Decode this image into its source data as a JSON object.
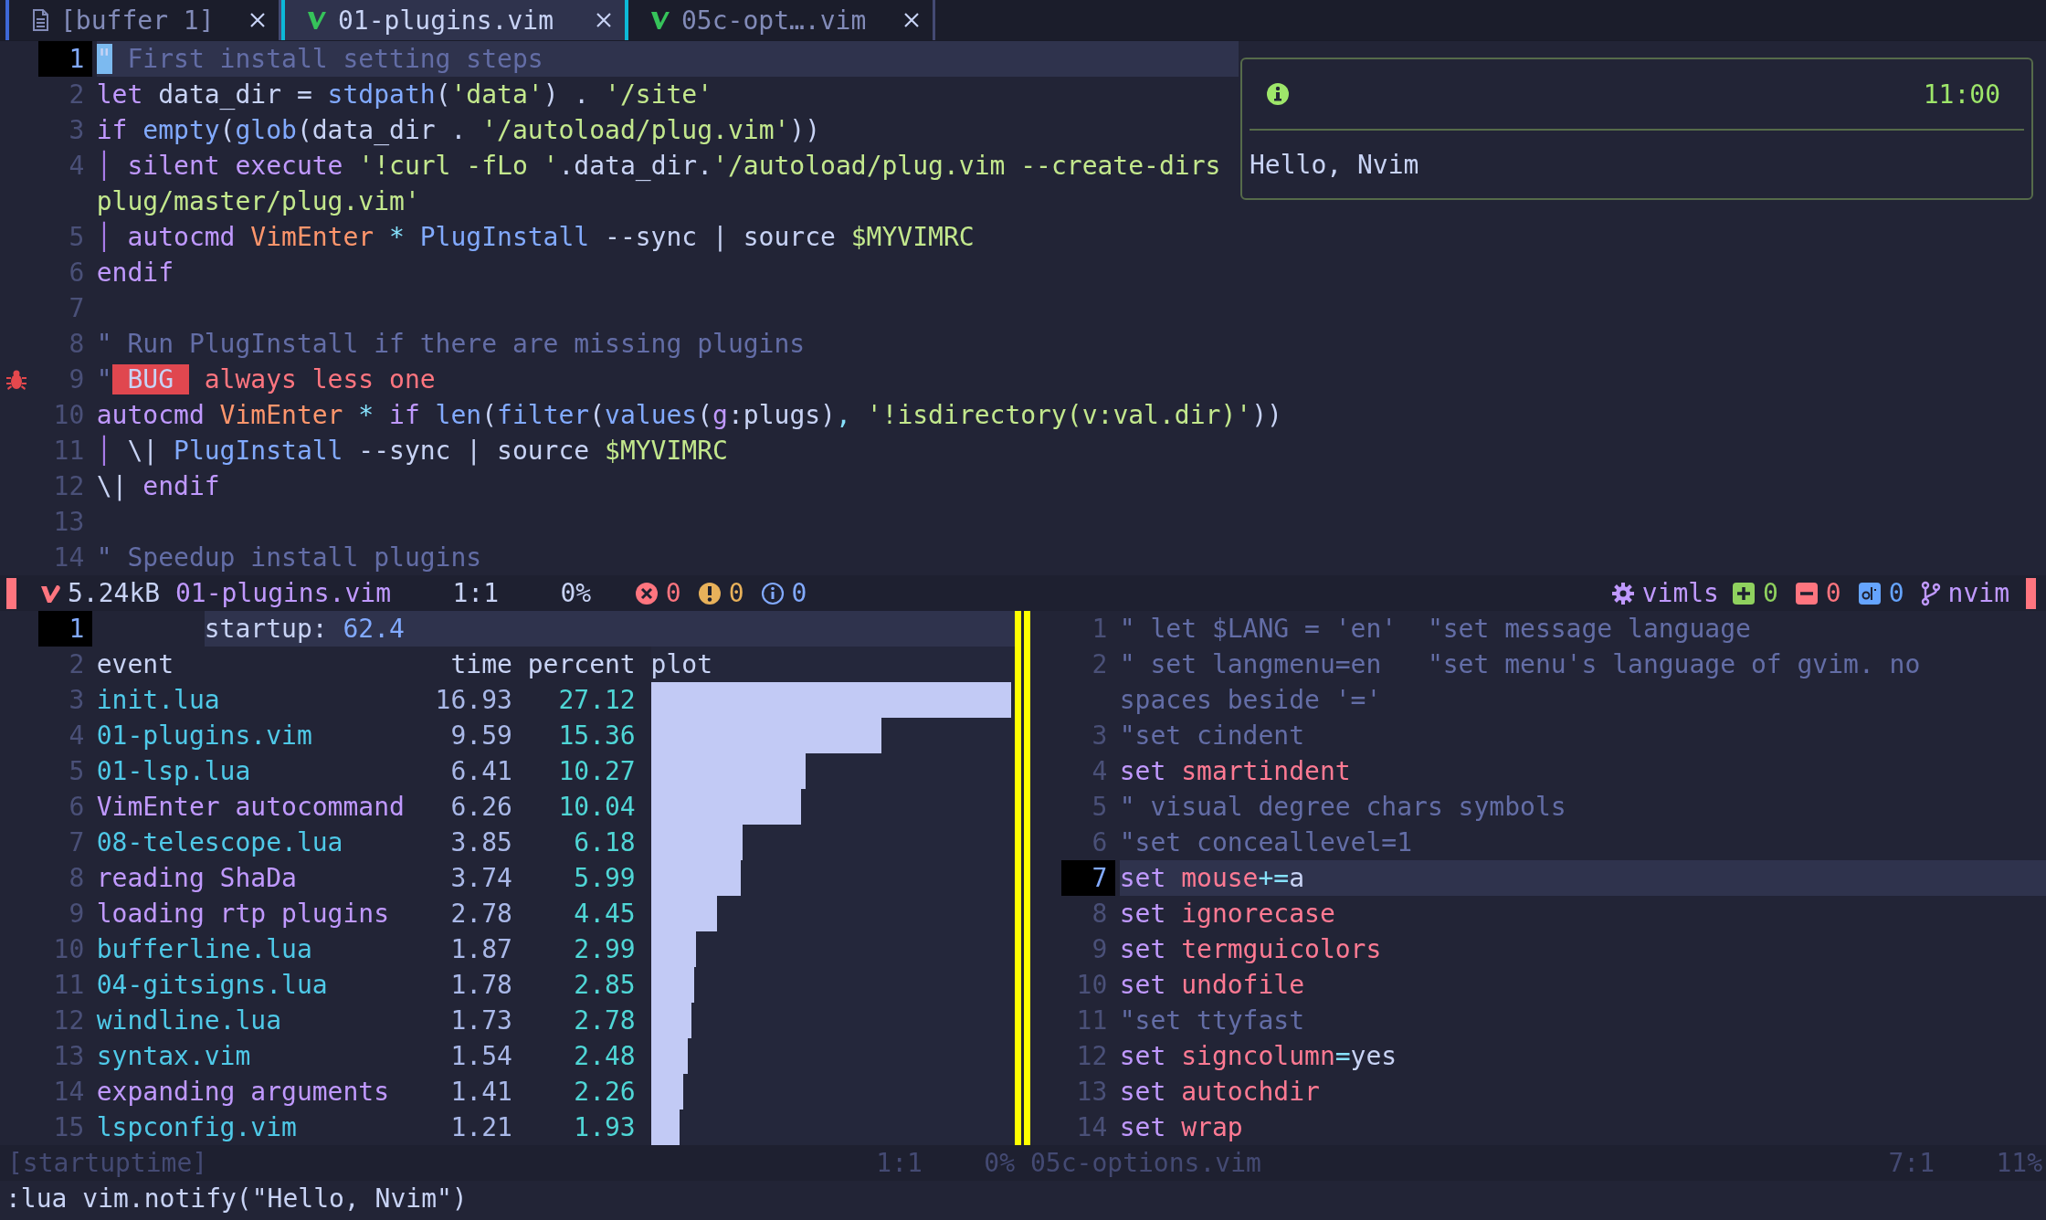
{
  "tabline": {
    "tabs": [
      {
        "label": "[buffer 1]",
        "kind": "scratch",
        "selected": false
      },
      {
        "label": "01-plugins.vim",
        "kind": "vim",
        "selected": true
      },
      {
        "label": "05c-opt….vim",
        "kind": "vim",
        "selected": false
      }
    ]
  },
  "top_editor": {
    "lines": [
      {
        "number": "1",
        "current": true,
        "tokens": [
          {
            "kind": "cursor",
            "text": "\""
          },
          {
            "kind": "comment",
            "text": " First install setting steps"
          }
        ]
      },
      {
        "number": "2",
        "current": false,
        "tokens": [
          {
            "kind": "keyword",
            "text": "let"
          },
          {
            "kind": "text",
            "text": " data_dir = "
          },
          {
            "kind": "function",
            "text": "stdpath"
          },
          {
            "kind": "text",
            "text": "("
          },
          {
            "kind": "string",
            "text": "'data'"
          },
          {
            "kind": "text",
            "text": ") . "
          },
          {
            "kind": "string",
            "text": "'/site'"
          }
        ]
      },
      {
        "number": "3",
        "current": false,
        "tokens": [
          {
            "kind": "keyword",
            "text": "if"
          },
          {
            "kind": "function",
            "text": " empty"
          },
          {
            "kind": "text",
            "text": "("
          },
          {
            "kind": "function",
            "text": "glob"
          },
          {
            "kind": "text",
            "text": "(data_dir . "
          },
          {
            "kind": "string",
            "text": "'/autoload/plug.vim'"
          },
          {
            "kind": "text",
            "text": "))"
          }
        ]
      },
      {
        "number": "4",
        "current": false,
        "tokens": [
          {
            "kind": "guide",
            "text": "│"
          },
          {
            "kind": "keyword",
            "text": " silent execute"
          },
          {
            "kind": "string",
            "text": " '!curl -fLo '"
          },
          {
            "kind": "text",
            "text": ".data_dir."
          },
          {
            "kind": "string",
            "text": "'/autoload/plug.vim --create-dirs"
          }
        ],
        "wrap": [
          {
            "kind": "string",
            "text": "plug/master/plug.vim'"
          }
        ]
      },
      {
        "number": "5",
        "current": false,
        "tokens": [
          {
            "kind": "guide",
            "text": "│"
          },
          {
            "kind": "keyword",
            "text": " autocmd"
          },
          {
            "kind": "type",
            "text": " VimEnter"
          },
          {
            "kind": "operator",
            "text": " *"
          },
          {
            "kind": "function",
            "text": " PlugInstall"
          },
          {
            "kind": "text",
            "text": " --sync | source "
          },
          {
            "kind": "string",
            "text": "$MYVIMRC"
          }
        ]
      },
      {
        "number": "6",
        "current": false,
        "tokens": [
          {
            "kind": "keyword",
            "text": "endif"
          }
        ]
      },
      {
        "number": "7",
        "current": false
      },
      {
        "number": "8",
        "current": false,
        "tokens": [
          {
            "kind": "comment",
            "text": "\" Run PlugInstall if there are missing plugins"
          }
        ]
      },
      {
        "number": "9",
        "current": false,
        "flagged": true,
        "tokens": [
          {
            "kind": "comment",
            "text": "\""
          },
          {
            "kind": "tag",
            "text": " BUG "
          },
          {
            "kind": "error",
            "text": " always less one"
          }
        ]
      },
      {
        "number": "10",
        "current": false,
        "tokens": [
          {
            "kind": "keyword",
            "text": "autocmd"
          },
          {
            "kind": "type",
            "text": " VimEnter"
          },
          {
            "kind": "operator",
            "text": " *"
          },
          {
            "kind": "keyword",
            "text": " if"
          },
          {
            "kind": "function",
            "text": " len"
          },
          {
            "kind": "text",
            "text": "("
          },
          {
            "kind": "function",
            "text": "filter"
          },
          {
            "kind": "text",
            "text": "("
          },
          {
            "kind": "function",
            "text": "values"
          },
          {
            "kind": "text",
            "text": "("
          },
          {
            "kind": "keyword",
            "text": "g"
          },
          {
            "kind": "text",
            "text": ":plugs)"
          },
          {
            "kind": "operator",
            "text": ","
          },
          {
            "kind": "string",
            "text": " '!isdirectory(v:val.dir)'"
          },
          {
            "kind": "text",
            "text": "))"
          }
        ]
      },
      {
        "number": "11",
        "current": false,
        "tokens": [
          {
            "kind": "guide",
            "text": "│"
          },
          {
            "kind": "text",
            "text": " \\| "
          },
          {
            "kind": "function",
            "text": "PlugInstall"
          },
          {
            "kind": "text",
            "text": " --sync | source "
          },
          {
            "kind": "string",
            "text": "$MYVIMRC"
          }
        ]
      },
      {
        "number": "12",
        "current": false,
        "tokens": [
          {
            "kind": "text",
            "text": "\\| "
          },
          {
            "kind": "keyword",
            "text": "endif"
          }
        ]
      },
      {
        "number": "13",
        "current": false
      },
      {
        "number": "14",
        "current": false,
        "tokens": [
          {
            "kind": "comment",
            "text": "\" Speedup install plugins"
          }
        ]
      }
    ]
  },
  "notification": {
    "time": "11:00",
    "message": "Hello, Nvim"
  },
  "statusline": {
    "size": "5.24kB",
    "file": "01-plugins.vim",
    "position": "1:1",
    "percent": "0%",
    "diagnostics": [
      {
        "kind": "error",
        "count": "0"
      },
      {
        "kind": "warning",
        "count": "0"
      },
      {
        "kind": "info",
        "count": "0"
      }
    ],
    "lsp": "vimls",
    "git": [
      {
        "kind": "added",
        "count": "0"
      },
      {
        "kind": "removed",
        "count": "0"
      },
      {
        "kind": "changed",
        "count": "0"
      }
    ],
    "branch": "nvim"
  },
  "startuptime": {
    "summary": {
      "number": "1",
      "current": true,
      "label": "startup:",
      "value": "62.4"
    },
    "header": {
      "number": "2",
      "columns": [
        "event",
        "time",
        "percent",
        "plot"
      ]
    },
    "rows": [
      {
        "number": "3",
        "kind": "file",
        "event": "init.lua",
        "time": "16.93",
        "percent": "27.12",
        "level": 1.0
      },
      {
        "number": "4",
        "kind": "file",
        "event": "01-plugins.vim",
        "time": "9.59",
        "percent": "15.36",
        "level": 0.641
      },
      {
        "number": "5",
        "kind": "file",
        "event": "01-lsp.lua",
        "time": "6.41",
        "percent": "10.27",
        "level": 0.429
      },
      {
        "number": "6",
        "kind": "event",
        "event": "VimEnter autocommand",
        "time": "6.26",
        "percent": "10.04",
        "level": 0.418
      },
      {
        "number": "7",
        "kind": "file",
        "event": "08-telescope.lua",
        "time": "3.85",
        "percent": "6.18",
        "level": 0.255
      },
      {
        "number": "8",
        "kind": "event",
        "event": "reading ShaDa",
        "time": "3.74",
        "percent": "5.99",
        "level": 0.249
      },
      {
        "number": "9",
        "kind": "event",
        "event": "loading rtp plugins",
        "time": "2.78",
        "percent": "4.45",
        "level": 0.184
      },
      {
        "number": "10",
        "kind": "file",
        "event": "bufferline.lua",
        "time": "1.87",
        "percent": "2.99",
        "level": 0.125
      },
      {
        "number": "11",
        "kind": "file",
        "event": "04-gitsigns.lua",
        "time": "1.78",
        "percent": "2.85",
        "level": 0.119
      },
      {
        "number": "12",
        "kind": "file",
        "event": "windline.lua",
        "time": "1.73",
        "percent": "2.78",
        "level": 0.113
      },
      {
        "number": "13",
        "kind": "file",
        "event": "syntax.vim",
        "time": "1.54",
        "percent": "2.48",
        "level": 0.102
      },
      {
        "number": "14",
        "kind": "event",
        "event": "expanding arguments",
        "time": "1.41",
        "percent": "2.26",
        "level": 0.091
      },
      {
        "number": "15",
        "kind": "file",
        "event": "lspconfig.vim",
        "time": "1.21",
        "percent": "1.93",
        "level": 0.08
      }
    ]
  },
  "options_editor": {
    "lines": [
      {
        "number": "1",
        "current": false,
        "tokens": [
          {
            "kind": "comment",
            "text": "\" let $LANG = 'en'  \"set message language"
          }
        ]
      },
      {
        "number": "2",
        "current": false,
        "tokens": [
          {
            "kind": "comment",
            "text": "\" set langmenu=en   \"set menu's language of gvim. no"
          }
        ],
        "wrap": [
          {
            "kind": "comment",
            "text": "spaces beside '='"
          }
        ]
      },
      {
        "number": "3",
        "current": false,
        "tokens": [
          {
            "kind": "comment",
            "text": "\"set cindent"
          }
        ]
      },
      {
        "number": "4",
        "current": false,
        "tokens": [
          {
            "kind": "keyword",
            "text": "set"
          },
          {
            "kind": "option",
            "text": " smartindent"
          }
        ]
      },
      {
        "number": "5",
        "current": false,
        "tokens": [
          {
            "kind": "comment",
            "text": "\" visual degree chars symbols"
          }
        ]
      },
      {
        "number": "6",
        "current": false,
        "tokens": [
          {
            "kind": "comment",
            "text": "\"set conceallevel=1"
          }
        ]
      },
      {
        "number": "7",
        "current": true,
        "tokens": [
          {
            "kind": "keyword",
            "text": "set"
          },
          {
            "kind": "option",
            "text": " mouse"
          },
          {
            "kind": "operator",
            "text": "+="
          },
          {
            "kind": "text",
            "text": "a"
          }
        ]
      },
      {
        "number": "8",
        "current": false,
        "tokens": [
          {
            "kind": "keyword",
            "text": "set"
          },
          {
            "kind": "option",
            "text": " ignorecase"
          }
        ]
      },
      {
        "number": "9",
        "current": false,
        "tokens": [
          {
            "kind": "keyword",
            "text": "set"
          },
          {
            "kind": "option",
            "text": " termguicolors"
          }
        ]
      },
      {
        "number": "10",
        "current": false,
        "tokens": [
          {
            "kind": "keyword",
            "text": "set"
          },
          {
            "kind": "option",
            "text": " undofile"
          }
        ]
      },
      {
        "number": "11",
        "current": false,
        "tokens": [
          {
            "kind": "comment",
            "text": "\"set ttyfast"
          }
        ]
      },
      {
        "number": "12",
        "current": false,
        "tokens": [
          {
            "kind": "keyword",
            "text": "set"
          },
          {
            "kind": "option",
            "text": " signcolumn"
          },
          {
            "kind": "operator",
            "text": "="
          },
          {
            "kind": "text",
            "text": "yes"
          }
        ]
      },
      {
        "number": "13",
        "current": false,
        "tokens": [
          {
            "kind": "keyword",
            "text": "set"
          },
          {
            "kind": "option",
            "text": " autochdir"
          }
        ]
      },
      {
        "number": "14",
        "current": false,
        "tokens": [
          {
            "kind": "keyword",
            "text": "set"
          },
          {
            "kind": "option",
            "text": " wrap"
          }
        ]
      }
    ]
  },
  "inactive_statuslines": [
    {
      "name": "[startuptime]",
      "position": "1:1",
      "percent": "0%"
    },
    {
      "name": "05c-options.vim",
      "position": "7:1",
      "percent": "11%"
    }
  ],
  "command_line": ":lua vim.notify(\"Hello, Nvim\")"
}
